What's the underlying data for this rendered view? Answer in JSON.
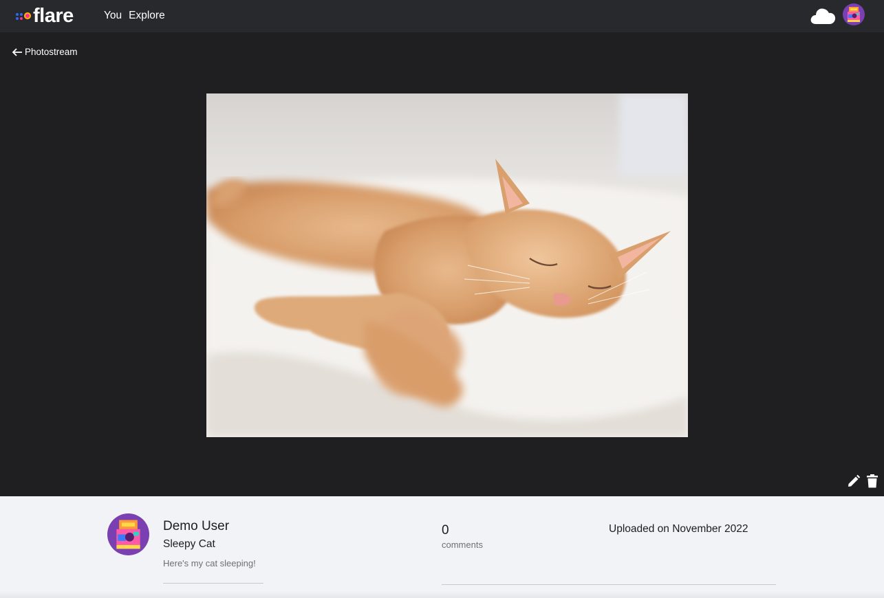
{
  "brand": {
    "name": "flare",
    "accent_colors": [
      "#2b6cf6",
      "#ff2d95",
      "#ffb400"
    ]
  },
  "nav": {
    "links": [
      {
        "label": "You"
      },
      {
        "label": "Explore"
      }
    ],
    "upload_icon": "cloud-upload-icon",
    "avatar_icon": "user-avatar"
  },
  "back": {
    "label": "Photostream",
    "icon": "arrow-left-icon"
  },
  "photo": {
    "alt": "sleeping orange cat"
  },
  "actions": {
    "edit_icon": "pencil-icon",
    "delete_icon": "trash-icon"
  },
  "info": {
    "username": "Demo User",
    "title": "Sleepy Cat",
    "description": "Here's my cat sleeping!",
    "comment_count": "0",
    "comment_label": "comments",
    "uploaded": "Uploaded on November 2022"
  },
  "colors": {
    "nav_bg": "#28292c",
    "stage_bg": "#1f1f21",
    "panel_bg": "#f2f3f6"
  }
}
